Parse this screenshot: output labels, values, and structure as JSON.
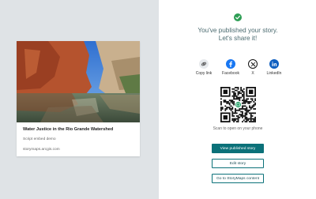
{
  "story_card": {
    "title": "Water Justice in the Rio Grande Watershed",
    "subtitle": "Script embed demo",
    "domain": "storymaps.arcgis.com"
  },
  "confirmation": {
    "line1": "You've published your story.",
    "line2": "Let's share it!",
    "icon": "check-circle-icon",
    "color": "#2e9e55"
  },
  "share": {
    "items": [
      {
        "label": "Copy link",
        "icon": "link-icon",
        "color": "#e6e9ec"
      },
      {
        "label": "Facebook",
        "icon": "facebook-icon",
        "color": "#1877f2"
      },
      {
        "label": "X",
        "icon": "x-icon",
        "color": "#111111"
      },
      {
        "label": "LinkedIn",
        "icon": "linkedin-icon",
        "color": "#1060c0"
      }
    ]
  },
  "qr": {
    "caption": "Scan to open on your phone"
  },
  "buttons": {
    "view": "View published story",
    "edit": "Edit story",
    "content": "Go to StoryMaps content"
  },
  "colors": {
    "primary": "#0b7179",
    "left_pane": "#dfe3e6"
  }
}
